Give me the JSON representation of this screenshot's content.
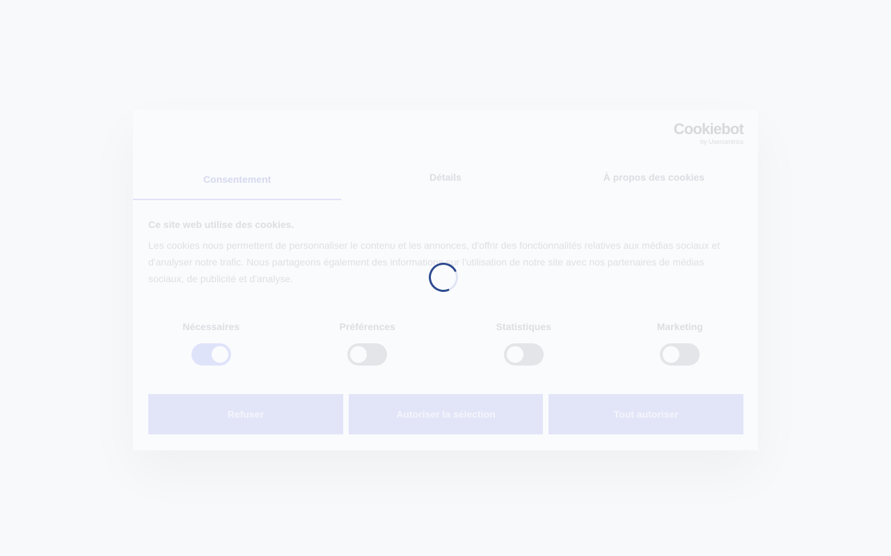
{
  "logo": {
    "wordmark": "Cookiebot",
    "tagline": "by Usercentrics"
  },
  "tabs": [
    {
      "label": "Consentement",
      "active": true
    },
    {
      "label": "Détails",
      "active": false
    },
    {
      "label": "À propos des cookies",
      "active": false
    }
  ],
  "consent": {
    "heading": "Ce site web utilise des cookies.",
    "body": "Les cookies nous permettent de personnaliser le contenu et les annonces, d'offrir des fonctionnalités relatives aux médias sociaux et d'analyser notre trafic. Nous partageons également des informations sur l'utilisation de notre site avec nos partenaires de médias sociaux, de publicité et d'analyse."
  },
  "categories": [
    {
      "label": "Nécessaires",
      "enabled": true
    },
    {
      "label": "Préférences",
      "enabled": false
    },
    {
      "label": "Statistiques",
      "enabled": false
    },
    {
      "label": "Marketing",
      "enabled": false
    }
  ],
  "buttons": {
    "deny": "Refuser",
    "allow_selection": "Autoriser la sélection",
    "allow_all": "Tout autoriser"
  },
  "colors": {
    "spinner": "#2c4a8f",
    "accent_faded": "#dfe3fa"
  },
  "status": {
    "loading_icon": "spinner-icon"
  }
}
